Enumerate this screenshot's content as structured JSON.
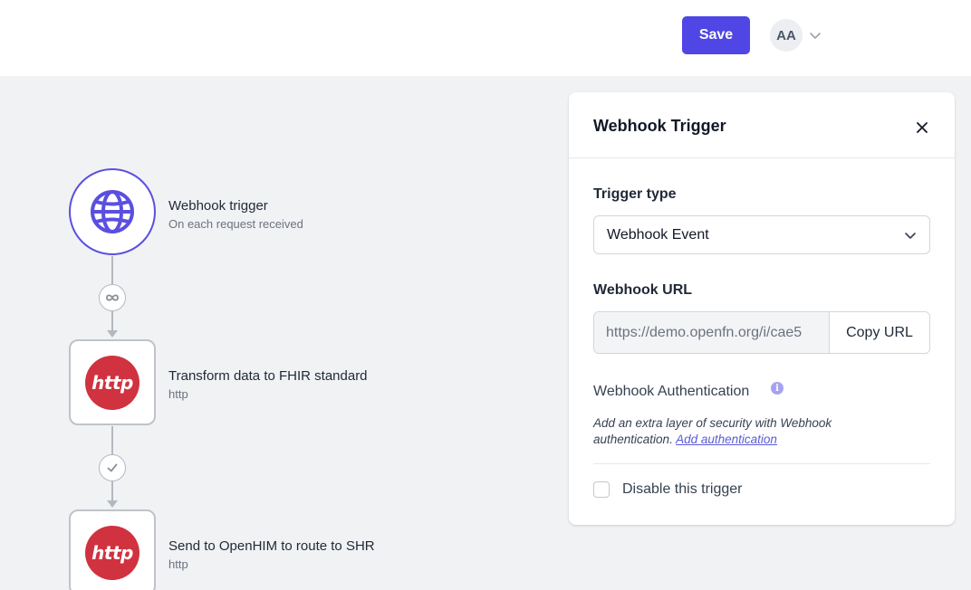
{
  "header": {
    "save_label": "Save",
    "avatar_initials": "AA"
  },
  "workflow": {
    "trigger": {
      "title": "Webhook trigger",
      "subtitle": "On each request received",
      "icon": "globe-icon"
    },
    "edges": [
      {
        "icon": "infinity-icon"
      },
      {
        "icon": "check-icon"
      }
    ],
    "jobs": [
      {
        "badge": "http",
        "title": "Transform data to FHIR standard",
        "subtitle": "http"
      },
      {
        "badge": "http",
        "title": "Send to OpenHIM to route to SHR",
        "subtitle": "http"
      }
    ]
  },
  "panel": {
    "title": "Webhook Trigger",
    "trigger_type_label": "Trigger type",
    "trigger_type_value": "Webhook Event",
    "webhook_url_label": "Webhook URL",
    "webhook_url_value": "https://demo.openfn.org/i/cae5",
    "copy_url_label": "Copy URL",
    "auth_title": "Webhook Authentication",
    "auth_description": "Add an extra layer of security with Webhook authentication.",
    "auth_link": "Add authentication",
    "disable_label": "Disable this trigger"
  },
  "colors": {
    "accent": "#4f46e5",
    "trigger_border": "#5b4fe0",
    "http_badge": "#d0323f",
    "canvas_bg": "#f1f2f4"
  }
}
